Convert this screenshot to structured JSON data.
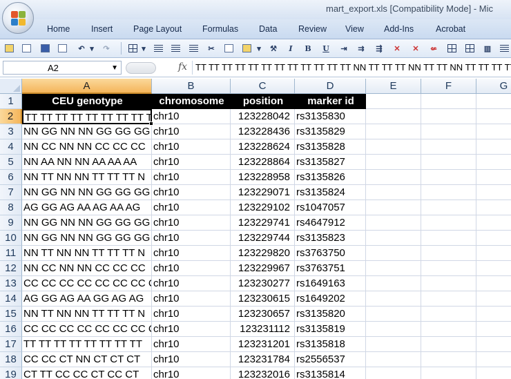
{
  "window": {
    "title": "mart_export.xls  [Compatibility Mode] - Mic"
  },
  "ribbon": {
    "tabs": [
      "Home",
      "Insert",
      "Page Layout",
      "Formulas",
      "Data",
      "Review",
      "View",
      "Add-Ins",
      "Acrobat"
    ]
  },
  "toolbar": {
    "icons": [
      "open-icon",
      "new-icon",
      "save-icon",
      "print-preview-icon",
      "undo-icon",
      "redo-icon",
      "borders-icon",
      "align-left-icon",
      "align-center-icon",
      "align-right-icon",
      "cut-icon",
      "copy-icon",
      "paste-icon",
      "format-painter-icon",
      "italic-icon",
      "bold-icon",
      "underline-icon"
    ],
    "bold_label": "B",
    "italic_label": "I",
    "underline_label": "U"
  },
  "formula_bar": {
    "name_box": "A2",
    "fx_label": "fx",
    "formula": "TT TT TT TT TT TT TT TT TT TT TT TT NN TT TT TT NN TT TT NN TT TT TT TT"
  },
  "sheet": {
    "columns": [
      "A",
      "B",
      "C",
      "D",
      "E",
      "F",
      "G"
    ],
    "rows": [
      "1",
      "2",
      "3",
      "4",
      "5",
      "6",
      "7",
      "8",
      "9",
      "10",
      "11",
      "12",
      "13",
      "14",
      "15",
      "16",
      "17",
      "18",
      "19"
    ],
    "selected_cell": "A2",
    "headers": [
      "CEU genotype",
      "chromosome",
      "position",
      "marker id"
    ],
    "data": [
      [
        "TT TT TT TT TT TT TT TT TT",
        "chr10",
        "123228042",
        "rs3135830"
      ],
      [
        "NN GG NN NN GG GG GG",
        "chr10",
        "123228436",
        "rs3135829"
      ],
      [
        "NN CC NN NN CC CC CC",
        "chr10",
        "123228624",
        "rs3135828"
      ],
      [
        "NN AA NN NN AA AA AA",
        "chr10",
        "123228864",
        "rs3135827"
      ],
      [
        "NN TT NN NN TT TT TT N",
        "chr10",
        "123228958",
        "rs3135826"
      ],
      [
        "NN GG NN NN GG GG GG",
        "chr10",
        "123229071",
        "rs3135824"
      ],
      [
        "AG GG AG AA AG AA AG",
        "chr10",
        "123229102",
        "rs1047057"
      ],
      [
        "NN GG NN NN GG GG GG",
        "chr10",
        "123229741",
        "rs4647912"
      ],
      [
        "NN GG NN NN GG GG GG",
        "chr10",
        "123229744",
        "rs3135823"
      ],
      [
        "NN TT NN NN TT TT TT N",
        "chr10",
        "123229820",
        "rs3763750"
      ],
      [
        "NN CC NN NN CC CC CC",
        "chr10",
        "123229967",
        "rs3763751"
      ],
      [
        "CC CC CC CC CC CC CC C",
        "chr10",
        "123230277",
        "rs1649163"
      ],
      [
        "AG GG AG AA GG AG AG",
        "chr10",
        "123230615",
        "rs1649202"
      ],
      [
        "NN TT NN NN TT TT TT N",
        "chr10",
        "123230657",
        "rs3135820"
      ],
      [
        "CC CC CC CC CC CC CC C",
        "chr10",
        "123231112",
        "rs3135819"
      ],
      [
        "TT TT TT TT TT TT TT TT",
        "chr10",
        "123231201",
        "rs3135818"
      ],
      [
        "CC CC CT NN CT CT CT",
        "chr10",
        "123231784",
        "rs2556537"
      ],
      [
        "CT TT CC CC CT CC CT",
        "chr10",
        "123232016",
        "rs3135814"
      ]
    ]
  },
  "colors": {
    "selected_header": "#f4b55b",
    "header_row_bg": "#000000",
    "ribbon_bg": "#c9daf0"
  }
}
